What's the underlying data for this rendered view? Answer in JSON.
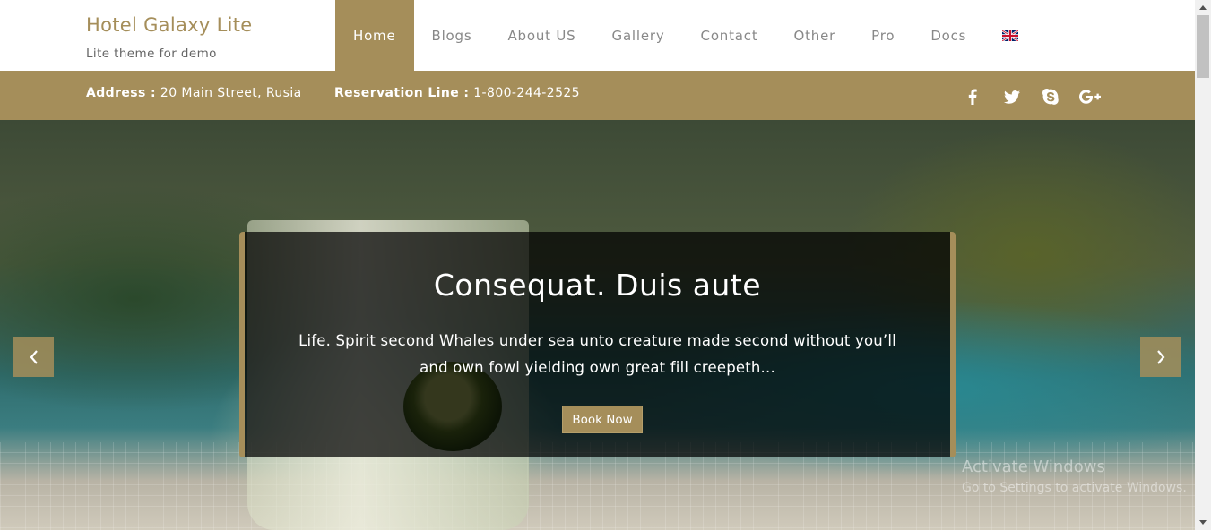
{
  "site": {
    "title": "Hotel Galaxy Lite",
    "tagline": "Lite theme for demo"
  },
  "nav": {
    "items": [
      {
        "label": "Home",
        "active": true
      },
      {
        "label": "Blogs"
      },
      {
        "label": "About US"
      },
      {
        "label": "Gallery"
      },
      {
        "label": "Contact"
      },
      {
        "label": "Other"
      },
      {
        "label": "Pro"
      },
      {
        "label": "Docs"
      }
    ],
    "language_icon": "uk-flag-icon"
  },
  "infobar": {
    "address_label": "Address :",
    "address_value": "20 Main Street, Rusia",
    "reservation_label": "Reservation Line :",
    "reservation_value": "1-800-244-2525",
    "social_icons": [
      "facebook-icon",
      "twitter-icon",
      "skype-icon",
      "google-plus-icon"
    ]
  },
  "slider": {
    "title": "Consequat. Duis aute",
    "text": "Life. Spirit second Whales under sea unto creature made second without you’ll and own fowl yielding own great fill creepeth...",
    "button_label": "Book Now",
    "prev_icon": "chevron-left-icon",
    "next_icon": "chevron-right-icon"
  },
  "watermark": {
    "line1": "Activate Windows",
    "line2": "Go to Settings to activate Windows."
  },
  "colors": {
    "accent": "#a58e5a",
    "header_bg": "#ffffff",
    "nav_text": "#888888"
  }
}
